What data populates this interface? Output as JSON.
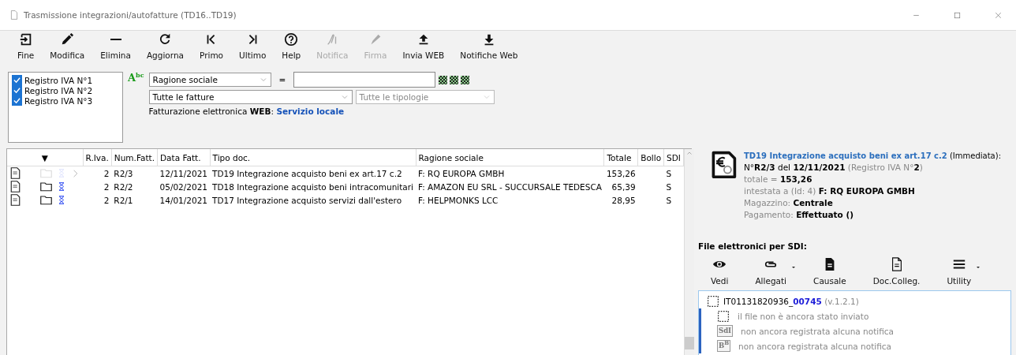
{
  "window": {
    "title": "Trasmissione integrazioni/autofatture (TD16..TD19)"
  },
  "toolbar": [
    {
      "label": "Fine",
      "disabled": false
    },
    {
      "label": "Modifica",
      "disabled": false
    },
    {
      "label": "Elimina",
      "disabled": false
    },
    {
      "label": "Aggiorna",
      "disabled": false
    },
    {
      "label": "Primo",
      "disabled": false
    },
    {
      "label": "Ultimo",
      "disabled": false
    },
    {
      "label": "Help",
      "disabled": false
    },
    {
      "label": "Notifica",
      "disabled": true
    },
    {
      "label": "Firma",
      "disabled": true
    },
    {
      "label": "Invia WEB",
      "disabled": false
    },
    {
      "label": "Notifiche Web",
      "disabled": false
    }
  ],
  "registers": [
    {
      "label": "Registro IVA N°1",
      "checked": true
    },
    {
      "label": "Registro IVA N°2",
      "checked": true
    },
    {
      "label": "Registro IVA N°3",
      "checked": true
    }
  ],
  "filter": {
    "badge": "A$^{bc}$",
    "field": "Ragione sociale",
    "operator": "=",
    "invoices": "Tutte le fatture",
    "types_placeholder": "Tutte le tipologie",
    "service": "Fatturazione elettronica **WEB**:",
    "service_link": "Servizio locale"
  },
  "table": {
    "columns": [
      "▼",
      "R.Iva.",
      "Num.Fatt.",
      "Data Fatt.",
      "Tipo doc.",
      "Ragione sociale",
      "Totale",
      "Bollo",
      "SDI"
    ],
    "rows": [
      {
        "selected": true,
        "folder": false,
        "cells": [
          "",
          "2",
          "R2/3",
          "12/11/2021",
          "TD19 Integrazione acquisto beni ex art.17 c.2",
          "F: RQ EUROPA GMBH",
          "153,26",
          "",
          "S"
        ]
      },
      {
        "selected": false,
        "folder": true,
        "cells": [
          "",
          "2",
          "R2/2",
          "05/02/2021",
          "TD18 Integrazione acquisto beni intracomunitari",
          "F: AMAZON EU SRL - SUCCURSALE TEDESCA",
          "65,39",
          "",
          "S"
        ]
      },
      {
        "selected": false,
        "folder": true,
        "cells": [
          "",
          "2",
          "R2/1",
          "14/01/2021",
          "TD17 Integrazione acquisto servizi dall'estero",
          "F: HELPMONKS LCC",
          "28,95",
          "",
          "S"
        ]
      }
    ]
  },
  "detail": {
    "title": "TD19 Integrazione acquisto beni ex art.17 c.2",
    "title_note": "(Immediata):",
    "lines": [
      {
        "label": "N°**R2/3** del **12/11/2021**",
        "note": "(Registro IVA N°**2**)"
      },
      {
        "label": "totale =",
        "value": "153,26"
      },
      {
        "label": "intestata a (Id: 4)",
        "value": "F: RQ EUROPA GMBH"
      },
      {
        "label": "Magazzino:",
        "value": "Centrale"
      },
      {
        "label": "Pagamento:",
        "value": "Effettuato ()"
      }
    ]
  },
  "sdi": {
    "heading": "File elettronici per SDI:",
    "buttons": [
      {
        "label": "Vedi",
        "dropdown": false
      },
      {
        "label": "Allegati",
        "dropdown": true
      },
      {
        "label": "Causale",
        "dropdown": false
      },
      {
        "label": "Doc.Colleg.",
        "dropdown": false
      },
      {
        "label": "Utility",
        "dropdown": true
      }
    ],
    "file": {
      "name": "IT01131820936_",
      "number": "00745",
      "version": "(v.1.2.1)",
      "expanded": true,
      "children": [
        {
          "kind": "pending",
          "text": "il file non è ancora stato inviato"
        },
        {
          "kind": "badge",
          "badge": "SdI",
          "text": "non ancora registrata alcuna notifica"
        },
        {
          "kind": "badge",
          "badge": "B$^{B}$",
          "text": "non ancora registrata alcuna notifica"
        }
      ]
    }
  }
}
